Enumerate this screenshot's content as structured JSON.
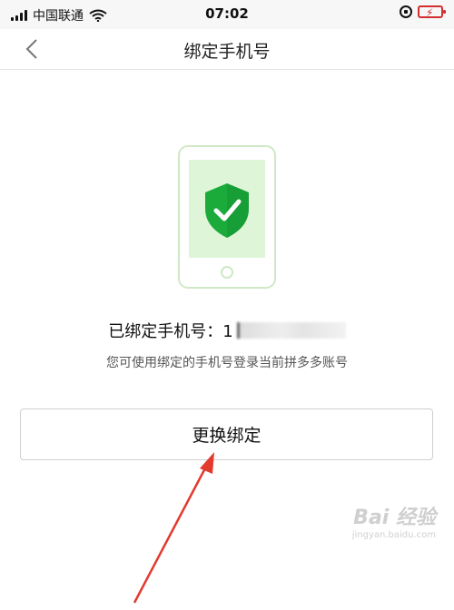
{
  "status_bar": {
    "carrier": "中国联通",
    "time": "07:02"
  },
  "nav": {
    "title": "绑定手机号"
  },
  "binding": {
    "label": "已绑定手机号：",
    "number_visible": "1",
    "hint": "您可使用绑定的手机号登录当前拼多多账号"
  },
  "action": {
    "change_button_label": "更换绑定"
  },
  "watermark": {
    "logo": "Bai 经验",
    "url": "jingyan.baidu.com"
  },
  "colors": {
    "shield_green": "#1aab3b",
    "phone_fill": "#dff5d7",
    "phone_border": "#cfe8c6",
    "arrow_red": "#e23a2d"
  }
}
